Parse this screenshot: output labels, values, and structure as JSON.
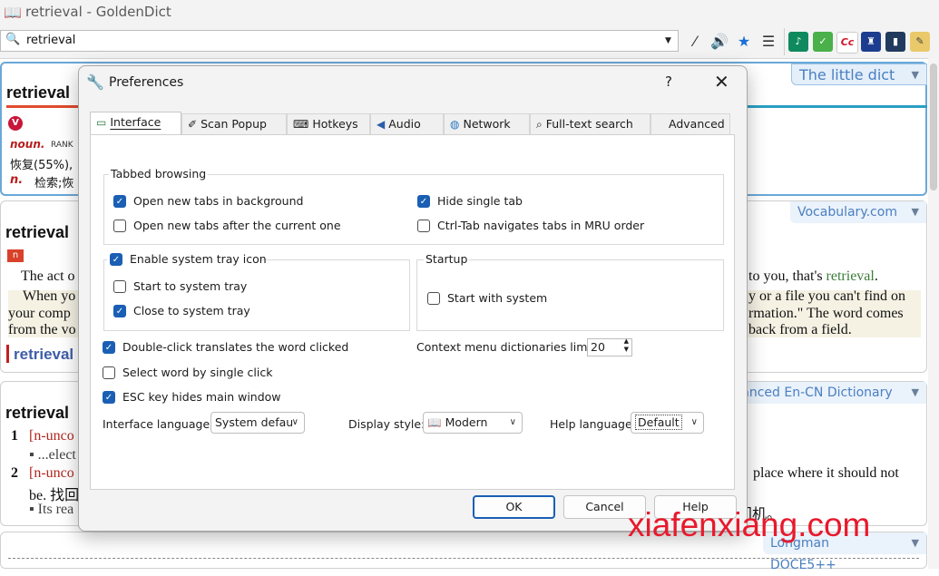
{
  "window": {
    "title": "retrieval - GoldenDict",
    "app_icon": "book-icon"
  },
  "search": {
    "value": "retrieval"
  },
  "toolbar_icons": [
    "magic-wand-icon",
    "speaker-icon",
    "star-icon",
    "list-icon"
  ],
  "dictionary_tiles": [
    {
      "label": "♪",
      "color": "#0f8a5f"
    },
    {
      "label": "✓",
      "color": "#49b04a"
    },
    {
      "label": "Cc",
      "color": "#ffffff"
    },
    {
      "label": "♜",
      "color": "#1c3d8f"
    },
    {
      "label": "▮",
      "color": "#223a5e"
    },
    {
      "label": "✎",
      "color": "#e9c96a"
    }
  ],
  "articles": {
    "card1": {
      "headword": "retrieval",
      "dict_name": "The little dict",
      "pos": "noun.",
      "rank_label": "RANK",
      "line1": "恢复(55%),",
      "pos2": "n.",
      "line2": "检索;恢"
    },
    "card2": {
      "headword": "retrieval",
      "dict_name": "Vocabulary.com",
      "badge": "n",
      "line1_left": "The act o",
      "line1_right": "to you, that's",
      "line1_link": "retrieval",
      "line1_end": ".",
      "line2_left": "When yo",
      "line2_right": "y or a file you can't find on",
      "line3_left": "your comp",
      "line3_right": "rmation.\" The word comes",
      "line4_left": "from the vo",
      "line4_right": "back from a field.",
      "sub_headword": "retrieval"
    },
    "card3": {
      "headword": "retrieval",
      "dict_name": "vanced En-CN Dictionary",
      "num1": "1",
      "sense1": "[n-unco",
      "example1": "▪ ...elect",
      "num2": "2",
      "sense2": "[n-unco",
      "sense2_right": "place where it should not",
      "sense2_cont": "be. 找回;",
      "example2": "▪ Its rea",
      "example2_right": "门机。"
    },
    "card4": {
      "dict_name": "Longman DOCE5++"
    }
  },
  "dialog": {
    "title": "Preferences",
    "help_symbol": "?",
    "close_symbol": "✕",
    "tabs": [
      {
        "label": "Interface",
        "icon": "monitor-icon",
        "glyph": "▭"
      },
      {
        "label": "Scan Popup",
        "icon": "wand-icon",
        "glyph": "✐"
      },
      {
        "label": "Hotkeys",
        "icon": "keyboard-icon",
        "glyph": "⌨"
      },
      {
        "label": "Audio",
        "icon": "speaker-icon",
        "glyph": "◀"
      },
      {
        "label": "Network",
        "icon": "globe-icon",
        "glyph": "◍"
      },
      {
        "label": "Full-text search",
        "icon": "magnifier-icon",
        "glyph": "⌕"
      },
      {
        "label": "Advanced",
        "icon": "",
        "glyph": ""
      }
    ],
    "tabbed_browsing": {
      "title": "Tabbed browsing",
      "open_bg": {
        "label": "Open new tabs in background",
        "checked": true
      },
      "open_after": {
        "label": "Open new tabs after the current one",
        "checked": false
      },
      "hide_single": {
        "label": "Hide single tab",
        "checked": true
      },
      "ctrl_tab": {
        "label": "Ctrl-Tab navigates tabs in MRU order",
        "checked": false
      }
    },
    "tray": {
      "title": "Enable system tray icon",
      "enabled": true,
      "start_tray": {
        "label": "Start to system tray",
        "checked": false
      },
      "close_tray": {
        "label": "Close to system tray",
        "checked": true
      }
    },
    "startup": {
      "title": "Startup",
      "start_system": {
        "label": "Start with system",
        "checked": false
      }
    },
    "double_click": {
      "label": "Double-click translates the word clicked",
      "checked": true
    },
    "single_click": {
      "label": "Select word by single click",
      "checked": false
    },
    "esc_key": {
      "label": "ESC key hides main window",
      "checked": true
    },
    "context_limit": {
      "label": "Context menu dictionaries limit:",
      "value": "20"
    },
    "interface_language": {
      "label": "Interface language:",
      "value": "System defau"
    },
    "display_style": {
      "label": "Display style:",
      "value": "Modern"
    },
    "help_language": {
      "label": "Help language",
      "value": "Default"
    },
    "buttons": {
      "ok": "OK",
      "cancel": "Cancel",
      "help": "Help"
    }
  },
  "watermark": "xiafenxiang.com",
  "colors": {
    "accent": "#1a5fb4",
    "link": "#4a7fc0",
    "watermark": "#e8192c"
  }
}
